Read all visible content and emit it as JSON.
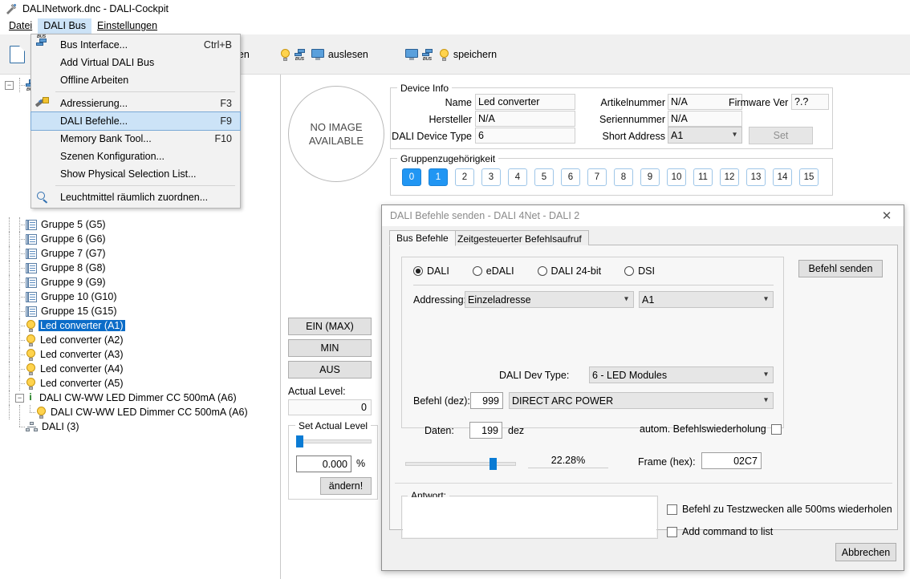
{
  "window": {
    "title": "DALINetwork.dnc - DALI-Cockpit",
    "icon": "wrench-icon"
  },
  "menubar": {
    "items": [
      {
        "label": "Datei",
        "active": false
      },
      {
        "label": "DALI Bus",
        "active": true
      },
      {
        "label": "Einstellungen",
        "active": false
      }
    ]
  },
  "dropdown": {
    "items": [
      {
        "label": "Bus Interface...",
        "shortcut": "Ctrl+B",
        "icon": "bus-icon",
        "selected": false
      },
      {
        "label": "Add Virtual DALI Bus",
        "shortcut": "",
        "icon": "",
        "selected": false
      },
      {
        "label": "Offline Arbeiten",
        "shortcut": "",
        "icon": "",
        "selected": false
      },
      {
        "separator": true
      },
      {
        "label": "Adressierung...",
        "shortcut": "F3",
        "icon": "wand-icon",
        "selected": false
      },
      {
        "label": "DALI Befehle...",
        "shortcut": "F9",
        "icon": "",
        "selected": true
      },
      {
        "label": "Memory Bank Tool...",
        "shortcut": "F10",
        "icon": "",
        "selected": false
      },
      {
        "label": "Szenen Konfiguration...",
        "shortcut": "",
        "icon": "",
        "selected": false
      },
      {
        "label": "Show Physical Selection List...",
        "shortcut": "",
        "icon": "",
        "selected": false
      },
      {
        "separator": true
      },
      {
        "label": "Leuchtmittel räumlich zuordnen...",
        "shortcut": "",
        "icon": "magnifier-icon",
        "selected": false
      }
    ]
  },
  "toolbar": {
    "new_label": "",
    "localize_label": "kalisieren",
    "read_label": "auslesen",
    "save_label": "speichern"
  },
  "tree": {
    "items": [
      {
        "label": "Gruppe 5 (G5)",
        "icon": "group-icon",
        "selected": false,
        "level": 2
      },
      {
        "label": "Gruppe 6 (G6)",
        "icon": "group-icon",
        "selected": false,
        "level": 2
      },
      {
        "label": "Gruppe 7 (G7)",
        "icon": "group-icon",
        "selected": false,
        "level": 2
      },
      {
        "label": "Gruppe 8 (G8)",
        "icon": "group-icon",
        "selected": false,
        "level": 2
      },
      {
        "label": "Gruppe 9 (G9)",
        "icon": "group-icon",
        "selected": false,
        "level": 2
      },
      {
        "label": "Gruppe 10 (G10)",
        "icon": "group-icon",
        "selected": false,
        "level": 2
      },
      {
        "label": "Gruppe 15 (G15)",
        "icon": "group-icon",
        "selected": false,
        "level": 2
      },
      {
        "label": "Led converter (A1)",
        "icon": "bulb-icon",
        "selected": true,
        "level": 2
      },
      {
        "label": "Led converter (A2)",
        "icon": "bulb-icon",
        "selected": false,
        "level": 2
      },
      {
        "label": "Led converter (A3)",
        "icon": "bulb-icon",
        "selected": false,
        "level": 2
      },
      {
        "label": "Led converter (A4)",
        "icon": "bulb-icon",
        "selected": false,
        "level": 2
      },
      {
        "label": "Led converter (A5)",
        "icon": "bulb-icon",
        "selected": false,
        "level": 2
      },
      {
        "label": "DALI CW-WW LED Dimmer CC 500mA (A6)",
        "icon": "device-icon",
        "selected": false,
        "level": 2,
        "expander": "minus"
      },
      {
        "label": "DALI CW-WW LED Dimmer CC 500mA (A6)",
        "icon": "bulb-icon",
        "selected": false,
        "level": 3
      },
      {
        "label": "DALI (3)",
        "icon": "network-icon",
        "selected": false,
        "level": 1
      }
    ]
  },
  "no_image": {
    "line1": "NO IMAGE",
    "line2": "AVAILABLE"
  },
  "device_info": {
    "legend": "Device Info",
    "name_label": "Name",
    "name_value": "Led converter",
    "hersteller_label": "Hersteller",
    "hersteller_value": "N/A",
    "devtype_label": "DALI Device Type",
    "devtype_value": "6",
    "artikel_label": "Artikelnummer",
    "artikel_value": "N/A",
    "serien_label": "Seriennummer",
    "serien_value": "N/A",
    "shortaddr_label": "Short Address",
    "shortaddr_value": "A1",
    "firmware_label": "Firmware Ver",
    "firmware_value": "?.?",
    "set_label": "Set"
  },
  "groups": {
    "legend": "Gruppenzugehörigkeit",
    "buttons": [
      {
        "label": "0",
        "on": true
      },
      {
        "label": "1",
        "on": true
      },
      {
        "label": "2",
        "on": false
      },
      {
        "label": "3",
        "on": false
      },
      {
        "label": "4",
        "on": false
      },
      {
        "label": "5",
        "on": false
      },
      {
        "label": "6",
        "on": false
      },
      {
        "label": "7",
        "on": false
      },
      {
        "label": "8",
        "on": false
      },
      {
        "label": "9",
        "on": false
      },
      {
        "label": "10",
        "on": false
      },
      {
        "label": "11",
        "on": false
      },
      {
        "label": "12",
        "on": false
      },
      {
        "label": "13",
        "on": false
      },
      {
        "label": "14",
        "on": false
      },
      {
        "label": "15",
        "on": false
      }
    ]
  },
  "level_panel": {
    "ein_label": "EIN (MAX)",
    "min_label": "MIN",
    "aus_label": "AUS",
    "actual_level_label": "Actual Level:",
    "actual_level_value": "0",
    "set_legend": "Set Actual Level",
    "slider_percent": 2,
    "value": "0.000",
    "unit": "%",
    "apply_label": "ändern!"
  },
  "dialog": {
    "title": "DALI Befehle senden - DALI 4Net - DALI 2",
    "close_icon": "close-icon",
    "tabs": [
      {
        "label": "Bus Befehle",
        "active": true
      },
      {
        "label": "Zeitgesteuerter Befehlsaufruf",
        "active": false
      }
    ],
    "protocols": [
      {
        "label": "DALI",
        "selected": true
      },
      {
        "label": "eDALI",
        "selected": false
      },
      {
        "label": "DALI 24-bit",
        "selected": false
      },
      {
        "label": "DSI",
        "selected": false
      }
    ],
    "send_label": "Befehl senden",
    "addressing_label": "Addressing:",
    "addressing_value": "Einzeladresse",
    "address_value": "A1",
    "devtype_label": "DALI Dev Type:",
    "devtype_value": "6 - LED Modules",
    "befehl_label": "Befehl (dez):",
    "befehl_value": "999",
    "command_value": "DIRECT ARC POWER",
    "daten_label": "Daten:",
    "daten_value": "199",
    "daten_unit": "dez",
    "autorepeat_label": "autom. Befehlswiederholung",
    "autorepeat_checked": false,
    "slider_percent": 79,
    "percent_value": "22.28%",
    "frame_label": "Frame (hex):",
    "frame_value": "02C7",
    "antwort_legend": "Antwort:",
    "antwort_value": "",
    "testrepeat_label": "Befehl zu Testzwecken alle 500ms wiederholen",
    "testrepeat_checked": false,
    "addtolist_label": "Add command to list",
    "addtolist_checked": false,
    "cancel_label": "Abbrechen"
  },
  "colors": {
    "accent": "#2196f3",
    "selection": "#0b6cc8",
    "menu_highlight": "#cce3f7",
    "slider": "#0a7bd4"
  }
}
